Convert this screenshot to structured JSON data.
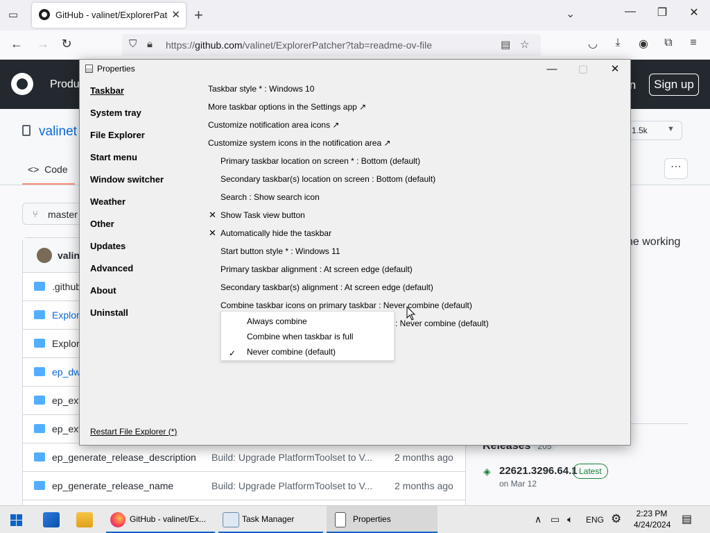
{
  "browser": {
    "tab_title": "GitHub - valinet/ExplorerPatch",
    "url_host": "github.com",
    "url_prefix": "https://",
    "url_path": "/valinet/ExplorerPatcher?tab=readme-ov-file"
  },
  "github": {
    "header_product": "Produ",
    "header_signin": "in",
    "sign_up": "Sign up",
    "repo_name": "valinet",
    "star_count": "1.5k",
    "code_tab": "Code",
    "branch": "master",
    "about_fragment": "he working",
    "commit_user": "valin",
    "files": [
      {
        "name": ".github",
        "msg": "",
        "date": "",
        "link": false
      },
      {
        "name": "Explore",
        "msg": "",
        "date": "",
        "link": true
      },
      {
        "name": "Explore",
        "msg": "",
        "date": "",
        "link": false
      },
      {
        "name": "ep_dw",
        "msg": "",
        "date": "",
        "link": true
      },
      {
        "name": "ep_ext",
        "msg": "",
        "date": "",
        "link": false
      },
      {
        "name": "ep_ext",
        "msg": "",
        "date": "",
        "link": false
      },
      {
        "name": "ep_generate_release_description",
        "msg": "Build: Upgrade PlatformToolset to V...",
        "date": "2 months ago",
        "link": false
      },
      {
        "name": "ep_generate_release_name",
        "msg": "Build: Upgrade PlatformToolset to V...",
        "date": "2 months ago",
        "link": false
      }
    ],
    "releases_label": "Releases",
    "releases_count": "205",
    "release_version": "22621.3296.64.1",
    "release_badge": "Latest",
    "release_date": "on Mar 12"
  },
  "dialog": {
    "title": "Properties",
    "nav": [
      {
        "label": "Taskbar",
        "active": true
      },
      {
        "label": "System tray",
        "active": false
      },
      {
        "label": "File Explorer",
        "active": false
      },
      {
        "label": "Start menu",
        "active": false
      },
      {
        "label": "Window switcher",
        "active": false
      },
      {
        "label": "Weather",
        "active": false
      },
      {
        "label": "Other",
        "active": false
      },
      {
        "label": "Updates",
        "active": false
      },
      {
        "label": "Advanced",
        "active": false
      },
      {
        "label": "About",
        "active": false
      },
      {
        "label": "Uninstall",
        "active": false
      }
    ],
    "settings": [
      "Taskbar style * : Windows 10",
      "More taskbar options in the Settings app ↗",
      "Customize notification area icons ↗",
      "Customize system icons in the notification area ↗",
      "Primary taskbar location on screen * : Bottom (default)",
      "Secondary taskbar(s) location on screen : Bottom (default)",
      "Search : Show search icon",
      "Show Task view button",
      "Automatically hide the taskbar",
      "Start button style * : Windows 11",
      "Primary taskbar alignment : At screen edge (default)",
      "Secondary taskbar(s) alignment : At screen edge (default)",
      "Combine taskbar icons on primary taskbar : Never combine (default)",
      ": Never combine (default)"
    ],
    "checked": [
      "Show Task view button",
      "Automatically hide the taskbar"
    ],
    "check_mark": "✕",
    "restart_link": "Restart File Explorer (*)",
    "dropdown": {
      "options": [
        "Always combine",
        "Combine when taskbar is full",
        "Never combine (default)"
      ],
      "selected": "Never combine (default)",
      "check_mark": "✓"
    }
  },
  "taskbar": {
    "apps": [
      {
        "label": "GitHub - valinet/Ex..."
      },
      {
        "label": "Task Manager"
      },
      {
        "label": "Properties"
      }
    ],
    "language": "ENG",
    "time": "2:23 PM",
    "date": "4/24/2024"
  },
  "colors": {
    "accent": "#0a64c8",
    "github_header": "#24292f",
    "link": "#0969da",
    "latest_badge": "#1a7f37"
  }
}
